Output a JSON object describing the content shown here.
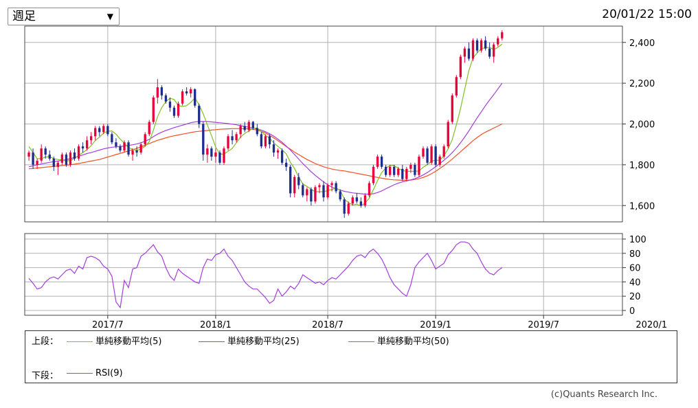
{
  "header": {
    "period_label": "週足",
    "dropdown_arrow": "▼",
    "timestamp": "20/01/22 15:00"
  },
  "colors": {
    "up": "#e8003a",
    "down": "#1c2d8f",
    "ma5": "#7fbf1f",
    "ma25": "#a33de0",
    "ma50": "#f05020",
    "rsi": "#a33de0",
    "grid": "#b0b0b0"
  },
  "chart_data": [
    {
      "type": "candlestick",
      "title": "",
      "x_ticks": [
        "2017/7",
        "2018/1",
        "2018/7",
        "2019/1",
        "2019/7",
        "2020/1"
      ],
      "y_ticks": [
        "1,600",
        "1,800",
        "2,000",
        "2,200",
        "2,400"
      ],
      "ylim": [
        1520,
        2480
      ],
      "x_range": [
        -1,
        143
      ],
      "x_tick_index": [
        19,
        45,
        72,
        98,
        124,
        150
      ],
      "grid": true,
      "candles": [
        [
          1840,
          1870,
          1820,
          1860
        ],
        [
          1860,
          1880,
          1780,
          1800
        ],
        [
          1800,
          1830,
          1780,
          1820
        ],
        [
          1820,
          1900,
          1810,
          1880
        ],
        [
          1880,
          1890,
          1830,
          1850
        ],
        [
          1850,
          1870,
          1820,
          1830
        ],
        [
          1830,
          1840,
          1770,
          1790
        ],
        [
          1790,
          1820,
          1750,
          1810
        ],
        [
          1810,
          1860,
          1800,
          1850
        ],
        [
          1850,
          1860,
          1790,
          1800
        ],
        [
          1800,
          1870,
          1790,
          1860
        ],
        [
          1860,
          1880,
          1820,
          1830
        ],
        [
          1830,
          1900,
          1820,
          1890
        ],
        [
          1890,
          1910,
          1860,
          1880
        ],
        [
          1880,
          1940,
          1870,
          1920
        ],
        [
          1920,
          1960,
          1900,
          1940
        ],
        [
          1940,
          1990,
          1920,
          1980
        ],
        [
          1980,
          1990,
          1940,
          1960
        ],
        [
          1960,
          2000,
          1950,
          1990
        ],
        [
          1990,
          2000,
          1940,
          1950
        ],
        [
          1950,
          1960,
          1900,
          1910
        ],
        [
          1910,
          1930,
          1880,
          1890
        ],
        [
          1890,
          1900,
          1860,
          1870
        ],
        [
          1870,
          1920,
          1860,
          1910
        ],
        [
          1910,
          1920,
          1840,
          1850
        ],
        [
          1850,
          1880,
          1820,
          1870
        ],
        [
          1870,
          1890,
          1840,
          1860
        ],
        [
          1860,
          1910,
          1850,
          1900
        ],
        [
          1900,
          1960,
          1890,
          1950
        ],
        [
          1950,
          2020,
          1940,
          2010
        ],
        [
          2010,
          2140,
          2000,
          2130
        ],
        [
          2130,
          2220,
          2100,
          2180
        ],
        [
          2180,
          2190,
          2120,
          2140
        ],
        [
          2140,
          2150,
          2100,
          2110
        ],
        [
          2110,
          2130,
          2060,
          2080
        ],
        [
          2080,
          2090,
          2030,
          2040
        ],
        [
          2040,
          2110,
          2030,
          2100
        ],
        [
          2100,
          2170,
          2090,
          2160
        ],
        [
          2160,
          2180,
          2140,
          2150
        ],
        [
          2150,
          2180,
          2130,
          2170
        ],
        [
          2170,
          2175,
          2080,
          2090
        ],
        [
          2090,
          2100,
          1980,
          2000
        ],
        [
          2000,
          2010,
          1820,
          1850
        ],
        [
          1850,
          1900,
          1810,
          1880
        ],
        [
          1880,
          1890,
          1820,
          1840
        ],
        [
          1840,
          1880,
          1810,
          1860
        ],
        [
          1860,
          1870,
          1800,
          1810
        ],
        [
          1810,
          1890,
          1800,
          1880
        ],
        [
          1880,
          1950,
          1870,
          1940
        ],
        [
          1940,
          1970,
          1900,
          1920
        ],
        [
          1920,
          1960,
          1910,
          1950
        ],
        [
          1950,
          2000,
          1930,
          1990
        ],
        [
          1990,
          2010,
          1960,
          1970
        ],
        [
          1970,
          2020,
          1960,
          2010
        ],
        [
          2010,
          2015,
          1970,
          1980
        ],
        [
          1980,
          2000,
          1940,
          1950
        ],
        [
          1950,
          1960,
          1880,
          1890
        ],
        [
          1890,
          1950,
          1880,
          1940
        ],
        [
          1940,
          1950,
          1880,
          1900
        ],
        [
          1900,
          1920,
          1840,
          1860
        ],
        [
          1860,
          1880,
          1830,
          1870
        ],
        [
          1870,
          1880,
          1800,
          1810
        ],
        [
          1810,
          1830,
          1770,
          1790
        ],
        [
          1790,
          1800,
          1640,
          1660
        ],
        [
          1660,
          1750,
          1640,
          1740
        ],
        [
          1740,
          1760,
          1680,
          1700
        ],
        [
          1700,
          1710,
          1640,
          1650
        ],
        [
          1650,
          1690,
          1620,
          1680
        ],
        [
          1680,
          1690,
          1600,
          1620
        ],
        [
          1620,
          1700,
          1610,
          1690
        ],
        [
          1690,
          1710,
          1660,
          1700
        ],
        [
          1700,
          1720,
          1620,
          1640
        ],
        [
          1640,
          1710,
          1630,
          1700
        ],
        [
          1700,
          1720,
          1670,
          1710
        ],
        [
          1710,
          1720,
          1660,
          1670
        ],
        [
          1670,
          1680,
          1620,
          1630
        ],
        [
          1630,
          1640,
          1540,
          1560
        ],
        [
          1560,
          1620,
          1550,
          1610
        ],
        [
          1610,
          1650,
          1600,
          1640
        ],
        [
          1640,
          1660,
          1610,
          1620
        ],
        [
          1620,
          1640,
          1590,
          1600
        ],
        [
          1600,
          1660,
          1590,
          1650
        ],
        [
          1650,
          1720,
          1640,
          1710
        ],
        [
          1710,
          1800,
          1700,
          1790
        ],
        [
          1790,
          1850,
          1780,
          1840
        ],
        [
          1840,
          1850,
          1780,
          1790
        ],
        [
          1790,
          1800,
          1740,
          1750
        ],
        [
          1750,
          1800,
          1740,
          1790
        ],
        [
          1790,
          1800,
          1740,
          1750
        ],
        [
          1750,
          1790,
          1740,
          1780
        ],
        [
          1780,
          1800,
          1720,
          1730
        ],
        [
          1730,
          1790,
          1720,
          1780
        ],
        [
          1780,
          1810,
          1760,
          1800
        ],
        [
          1800,
          1810,
          1740,
          1750
        ],
        [
          1750,
          1850,
          1740,
          1840
        ],
        [
          1840,
          1890,
          1830,
          1880
        ],
        [
          1880,
          1890,
          1800,
          1810
        ],
        [
          1810,
          1900,
          1800,
          1890
        ],
        [
          1890,
          1900,
          1790,
          1800
        ],
        [
          1800,
          1850,
          1790,
          1840
        ],
        [
          1840,
          1900,
          1830,
          1890
        ],
        [
          1890,
          2020,
          1880,
          2010
        ],
        [
          2010,
          2150,
          2000,
          2140
        ],
        [
          2140,
          2240,
          2130,
          2230
        ],
        [
          2230,
          2340,
          2220,
          2330
        ],
        [
          2330,
          2380,
          2300,
          2370
        ],
        [
          2370,
          2400,
          2310,
          2320
        ],
        [
          2320,
          2420,
          2310,
          2410
        ],
        [
          2410,
          2420,
          2350,
          2360
        ],
        [
          2360,
          2420,
          2350,
          2410
        ],
        [
          2410,
          2430,
          2360,
          2370
        ],
        [
          2370,
          2400,
          2320,
          2330
        ],
        [
          2330,
          2400,
          2300,
          2390
        ],
        [
          2390,
          2430,
          2380,
          2420
        ],
        [
          2420,
          2460,
          2410,
          2450
        ]
      ],
      "ma5": [
        1890,
        1860,
        1830,
        1830,
        1838,
        1840,
        1830,
        1826,
        1824,
        1818,
        1822,
        1830,
        1846,
        1860,
        1874,
        1894,
        1918,
        1936,
        1956,
        1964,
        1966,
        1950,
        1926,
        1906,
        1884,
        1876,
        1870,
        1878,
        1890,
        1914,
        1970,
        2036,
        2080,
        2110,
        2126,
        2120,
        2090,
        2086,
        2090,
        2106,
        2128,
        2094,
        2050,
        1996,
        1942,
        1888,
        1852,
        1852,
        1866,
        1880,
        1908,
        1936,
        1954,
        1966,
        1978,
        1980,
        1962,
        1944,
        1930,
        1908,
        1890,
        1874,
        1854,
        1812,
        1782,
        1740,
        1706,
        1694,
        1680,
        1668,
        1668,
        1668,
        1674,
        1678,
        1686,
        1674,
        1632,
        1614,
        1604,
        1606,
        1598,
        1612,
        1636,
        1678,
        1722,
        1762,
        1784,
        1796,
        1796,
        1782,
        1772,
        1768,
        1768,
        1768,
        1770,
        1788,
        1800,
        1818,
        1822,
        1822,
        1844,
        1878,
        1924,
        1996,
        2076,
        2170,
        2262,
        2324,
        2348,
        2370,
        2374,
        2376,
        2364,
        2376,
        2392
      ],
      "ma25": [
        1790,
        1795,
        1800,
        1804,
        1808,
        1812,
        1815,
        1818,
        1822,
        1825,
        1830,
        1836,
        1842,
        1848,
        1855,
        1860,
        1866,
        1872,
        1878,
        1882,
        1886,
        1888,
        1890,
        1892,
        1895,
        1898,
        1902,
        1908,
        1915,
        1925,
        1938,
        1950,
        1960,
        1968,
        1975,
        1982,
        1988,
        1994,
        2000,
        2006,
        2010,
        2012,
        2012,
        2012,
        2010,
        2008,
        2006,
        2004,
        2002,
        1999,
        1996,
        1992,
        1988,
        1984,
        1980,
        1976,
        1970,
        1962,
        1952,
        1940,
        1926,
        1910,
        1892,
        1872,
        1850,
        1828,
        1806,
        1786,
        1766,
        1748,
        1732,
        1716,
        1702,
        1690,
        1682,
        1676,
        1670,
        1666,
        1662,
        1660,
        1658,
        1656,
        1656,
        1658,
        1664,
        1672,
        1682,
        1692,
        1702,
        1710,
        1716,
        1720,
        1726,
        1732,
        1740,
        1750,
        1762,
        1776,
        1790,
        1806,
        1822,
        1840,
        1860,
        1882,
        1908,
        1936,
        1966,
        1998,
        2030,
        2060,
        2090,
        2118,
        2144,
        2172,
        2200
      ],
      "ma50": [
        1780,
        1782,
        1784,
        1786,
        1788,
        1790,
        1792,
        1794,
        1796,
        1798,
        1800,
        1803,
        1806,
        1810,
        1814,
        1818,
        1822,
        1826,
        1832,
        1838,
        1844,
        1850,
        1856,
        1862,
        1868,
        1874,
        1880,
        1888,
        1896,
        1904,
        1912,
        1920,
        1926,
        1932,
        1938,
        1942,
        1946,
        1950,
        1954,
        1958,
        1962,
        1964,
        1966,
        1968,
        1970,
        1972,
        1974,
        1975,
        1976,
        1977,
        1977,
        1977,
        1977,
        1976,
        1974,
        1970,
        1964,
        1956,
        1944,
        1932,
        1918,
        1904,
        1890,
        1876,
        1862,
        1850,
        1838,
        1826,
        1816,
        1806,
        1798,
        1790,
        1784,
        1779,
        1775,
        1772,
        1770,
        1766,
        1762,
        1758,
        1754,
        1750,
        1746,
        1742,
        1738,
        1734,
        1731,
        1728,
        1726,
        1725,
        1724,
        1724,
        1725,
        1728,
        1732,
        1738,
        1746,
        1756,
        1768,
        1782,
        1796,
        1812,
        1828,
        1846,
        1864,
        1882,
        1900,
        1918,
        1934,
        1948,
        1960,
        1970,
        1980,
        1990,
        2000
      ]
    },
    {
      "type": "line",
      "title": "RSI",
      "y_ticks": [
        "0",
        "20",
        "40",
        "60",
        "80",
        "100"
      ],
      "ylim": [
        0,
        100
      ],
      "grid": true,
      "rsi": [
        45,
        38,
        30,
        32,
        40,
        45,
        47,
        44,
        50,
        56,
        58,
        52,
        62,
        58,
        74,
        76,
        74,
        70,
        62,
        58,
        48,
        12,
        4,
        42,
        32,
        58,
        60,
        76,
        80,
        86,
        92,
        82,
        76,
        60,
        48,
        42,
        58,
        52,
        48,
        44,
        40,
        38,
        60,
        72,
        70,
        78,
        80,
        86,
        76,
        70,
        60,
        50,
        40,
        34,
        30,
        30,
        24,
        18,
        10,
        14,
        30,
        20,
        26,
        34,
        30,
        38,
        50,
        46,
        42,
        38,
        40,
        36,
        42,
        46,
        44,
        50,
        56,
        62,
        70,
        76,
        78,
        74,
        82,
        86,
        80,
        72,
        60,
        46,
        36,
        30,
        24,
        20,
        36,
        60,
        68,
        74,
        80,
        70,
        58,
        62,
        66,
        78,
        84,
        92,
        96,
        96,
        94,
        86,
        80,
        68,
        58,
        52,
        50,
        56,
        60
      ]
    }
  ],
  "legend": {
    "top_label": "上段：",
    "bottom_label": "下段：",
    "items": [
      {
        "label": "単純移動平均(5)"
      },
      {
        "label": "単純移動平均(25)"
      },
      {
        "label": "単純移動平均(50)"
      }
    ],
    "rsi_label": "RSI(9)"
  },
  "footer": {
    "copyright": "(c)Quants Research Inc."
  }
}
